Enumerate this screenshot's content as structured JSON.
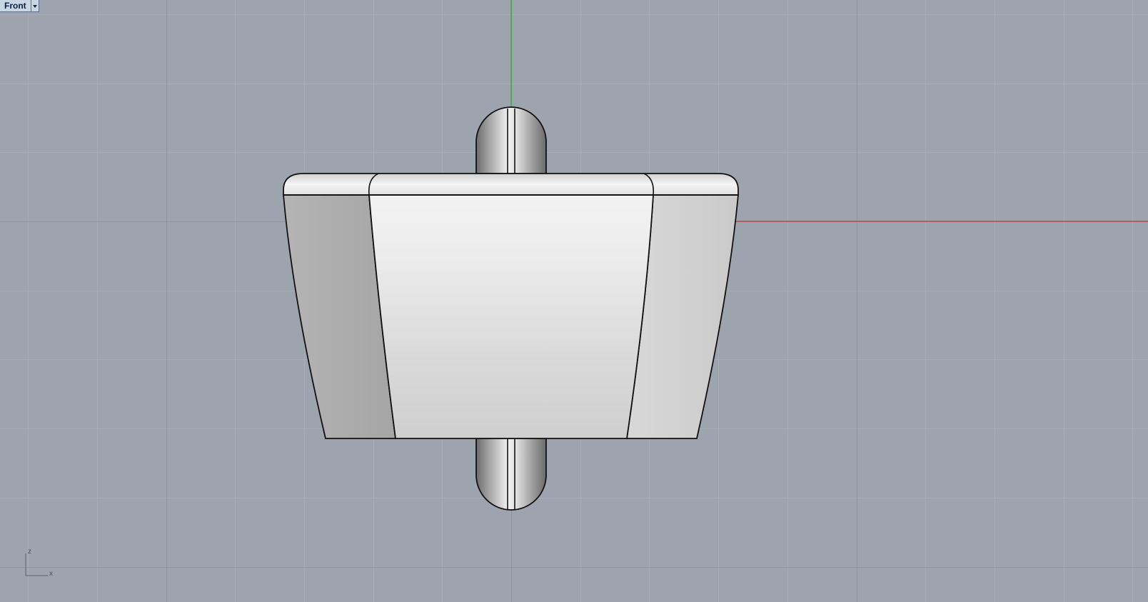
{
  "viewport": {
    "name": "Front",
    "background": "#9ea4ae"
  },
  "gizmo": {
    "vertical_axis": "z",
    "horizontal_axis": "x"
  },
  "colors": {
    "grid_minor": "#a8aeb8",
    "grid_major": "#8e949e",
    "x_axis": "#b8494c",
    "y_axis": "#2faf3a",
    "outline": "#111111"
  }
}
